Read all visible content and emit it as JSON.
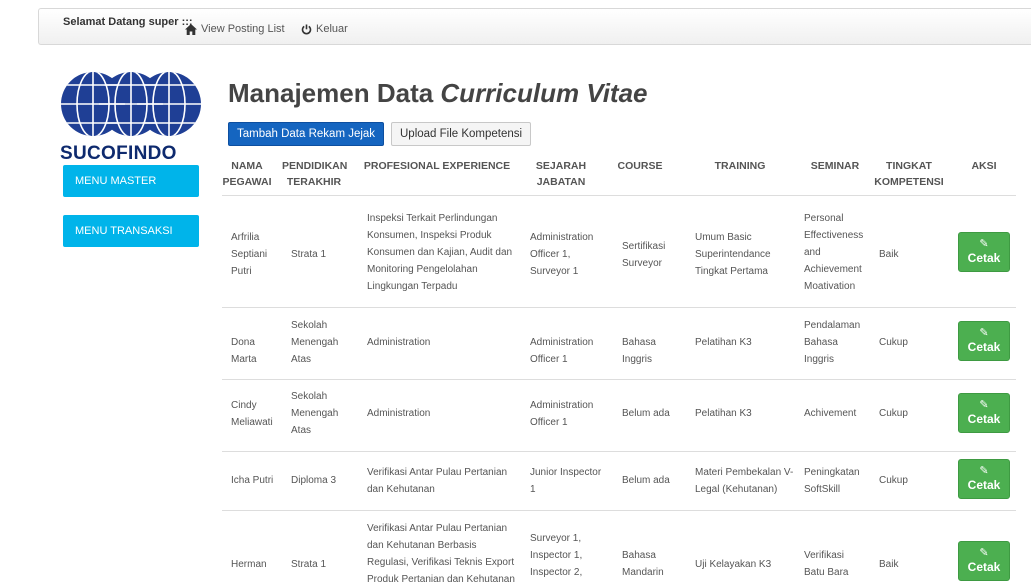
{
  "topbar": {
    "welcome": "Selamat Datang super :::",
    "view_posting": "View Posting List",
    "logout": "Keluar"
  },
  "logo_text": "SUCOFINDO",
  "sidebar": {
    "menu_master": "MENU MASTER",
    "menu_transaksi": "MENU TRANSAKSI"
  },
  "page": {
    "title_plain": "Manajemen Data ",
    "title_italic": "Curriculum Vitae",
    "btn_add": "Tambah Data Rekam Jejak",
    "btn_upload": "Upload File Kompetensi"
  },
  "table": {
    "headers": [
      "NAMA PEGAWAI",
      "PENDIDIKAN TERAKHIR",
      "PROFESIONAL EXPERIENCE",
      "SEJARAH JABATAN",
      "COURSE",
      "TRAINING",
      "SEMINAR",
      "TINGKAT KOMPETENSI",
      "AKSI"
    ],
    "action_label": "Cetak",
    "rows": [
      {
        "nama": "Arfrilia Septiani Putri",
        "pendidikan": "Strata 1",
        "pengalaman": "Inspeksi Terkait Perlindungan Konsumen, Inspeksi Produk Konsumen dan Kajian, Audit dan Monitoring Pengelolahan Lingkungan Terpadu",
        "jabatan": "Administration Officer 1, Surveyor 1",
        "course": "Sertifikasi Surveyor",
        "training": "Umum Basic Superintendance Tingkat Pertama",
        "seminar": "Personal Effectiveness and Achievement Moativation",
        "kompetensi": "Baik"
      },
      {
        "nama": "Dona Marta",
        "pendidikan": "Sekolah Menengah Atas",
        "pengalaman": "Administration",
        "jabatan": "Administration Officer 1",
        "course": "Bahasa Inggris",
        "training": "Pelatihan K3",
        "seminar": "Pendalaman Bahasa Inggris",
        "kompetensi": "Cukup"
      },
      {
        "nama": "Cindy Meliawati",
        "pendidikan": "Sekolah Menengah Atas",
        "pengalaman": "Administration",
        "jabatan": "Administration Officer 1",
        "course": "Belum ada",
        "training": "Pelatihan K3",
        "seminar": "Achivement",
        "kompetensi": "Cukup"
      },
      {
        "nama": "Icha Putri",
        "pendidikan": "Diploma 3",
        "pengalaman": "Verifikasi Antar Pulau Pertanian dan Kehutanan",
        "jabatan": "Junior Inspector 1",
        "course": "Belum ada",
        "training": "Materi Pembekalan V-Legal (Kehutanan)",
        "seminar": "Peningkatan SoftSkill",
        "kompetensi": "Cukup"
      },
      {
        "nama": "Herman",
        "pendidikan": "Strata 1",
        "pengalaman": "Verifikasi Antar Pulau Pertanian dan Kehutanan Berbasis Regulasi, Verifikasi Teknis Export Produk Pertanian dan Kehutanan",
        "jabatan": "Surveyor 1, Inspector 1, Inspector 2,",
        "course": "Bahasa Mandarin",
        "training": "Uji Kelayakan K3",
        "seminar": "Verifikasi Batu Bara",
        "kompetensi": "Baik"
      }
    ]
  },
  "colors": {
    "menu": "#00b4ea",
    "primary": "#1565c0",
    "cetak": "#4caf50",
    "logo": "#0e2a6e"
  }
}
